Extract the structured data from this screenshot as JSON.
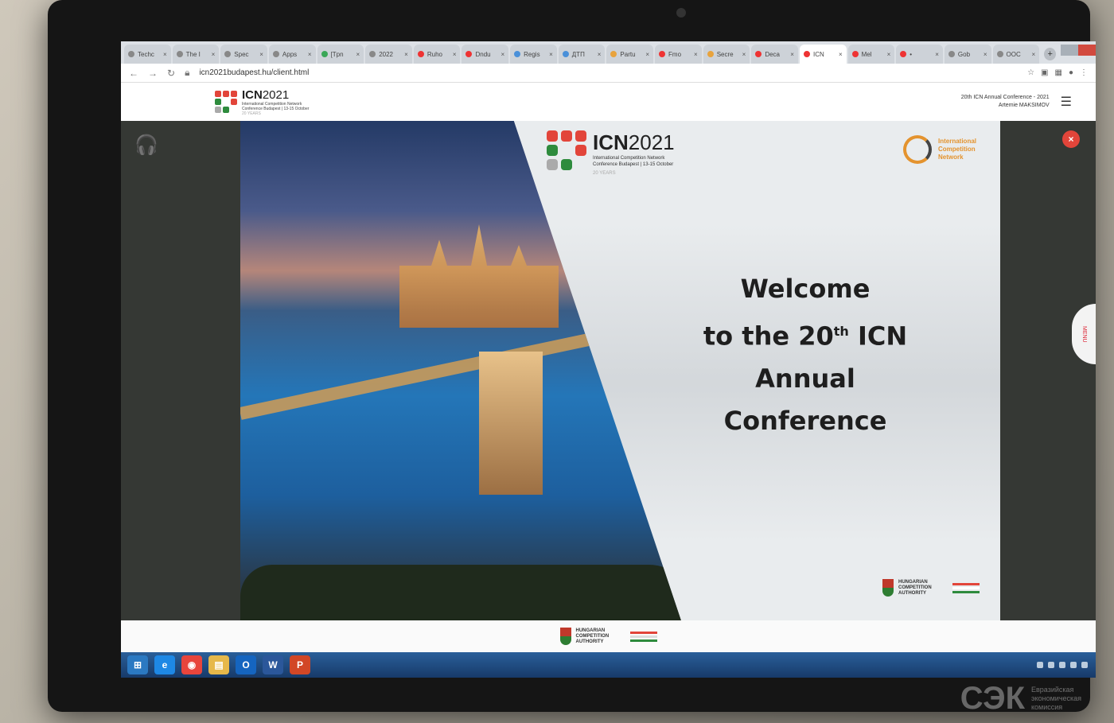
{
  "browser": {
    "tabs": [
      {
        "label": "Techc",
        "color": "#888"
      },
      {
        "label": "The I",
        "color": "#888"
      },
      {
        "label": "Spec",
        "color": "#888"
      },
      {
        "label": "Apps",
        "color": "#888"
      },
      {
        "label": "[Tpn",
        "color": "#3aa757"
      },
      {
        "label": "2022",
        "color": "#888"
      },
      {
        "label": "Ruho",
        "color": "#e33"
      },
      {
        "label": "Dndu",
        "color": "#e33"
      },
      {
        "label": "Regis",
        "color": "#4a90d9"
      },
      {
        "label": "ДТП",
        "color": "#4a90d9"
      },
      {
        "label": "Partu",
        "color": "#e8a33d"
      },
      {
        "label": "Fmo",
        "color": "#e33"
      },
      {
        "label": "Secre",
        "color": "#e8a33d"
      },
      {
        "label": "Deca",
        "color": "#e33"
      },
      {
        "label": "ICN",
        "color": "#e33"
      },
      {
        "label": "Mel",
        "color": "#e33"
      },
      {
        "label": "•",
        "color": "#e33"
      },
      {
        "label": "Gob",
        "color": "#888"
      },
      {
        "label": "ООС",
        "color": "#888"
      }
    ],
    "url": "icn2021budapest.hu/client.html",
    "close_icon": "×",
    "newtab_icon": "+"
  },
  "header": {
    "logo_text": "ICN",
    "logo_year": "2021",
    "logo_sub": "International Competition Network Conference Budapest | 13-15 October",
    "logo_years": "20 YEARS",
    "event_title": "20th ICN Annual Conference - 2021",
    "user_name": "Artemie MAKSIMOV",
    "menu_icon": "☰"
  },
  "slide": {
    "logo_text": "ICN",
    "logo_year": "2021",
    "logo_sub": "International Competition Network Conference Budapest | 13-15 October",
    "logo_years": "20 YEARS",
    "network_name": "International Competition Network",
    "welcome_line1": "Welcome",
    "welcome_line2_a": "to the 20",
    "welcome_line2_sup": "th",
    "welcome_line2_b": " ICN",
    "welcome_line3": "Annual Conference",
    "hca_name": "HUNGARIAN COMPETITION AUTHORITY"
  },
  "controls": {
    "headphone_icon": "🎧",
    "close_icon": "×",
    "sidetab_label": "MENU"
  },
  "footer": {
    "hca_name": "HUNGARIAN COMPETITION AUTHORITY"
  },
  "taskbar": {
    "items": [
      {
        "name": "start",
        "glyph": "⊞",
        "color": "#2b79c2"
      },
      {
        "name": "ie",
        "glyph": "e",
        "color": "#1e88e5"
      },
      {
        "name": "chrome",
        "glyph": "◉",
        "color": "#e8453c"
      },
      {
        "name": "explorer",
        "glyph": "▤",
        "color": "#e6b84a"
      },
      {
        "name": "outlook",
        "glyph": "O",
        "color": "#1565c0"
      },
      {
        "name": "word",
        "glyph": "W",
        "color": "#2b579a"
      },
      {
        "name": "powerpoint",
        "glyph": "P",
        "color": "#d24726"
      }
    ]
  },
  "watermark": {
    "big": "СЭК",
    "small": "Евразийская экономическая комиссия"
  },
  "colors": {
    "brand_red": "#e2453a",
    "brand_green": "#2e8b3d",
    "accent_orange": "#e4932e"
  }
}
